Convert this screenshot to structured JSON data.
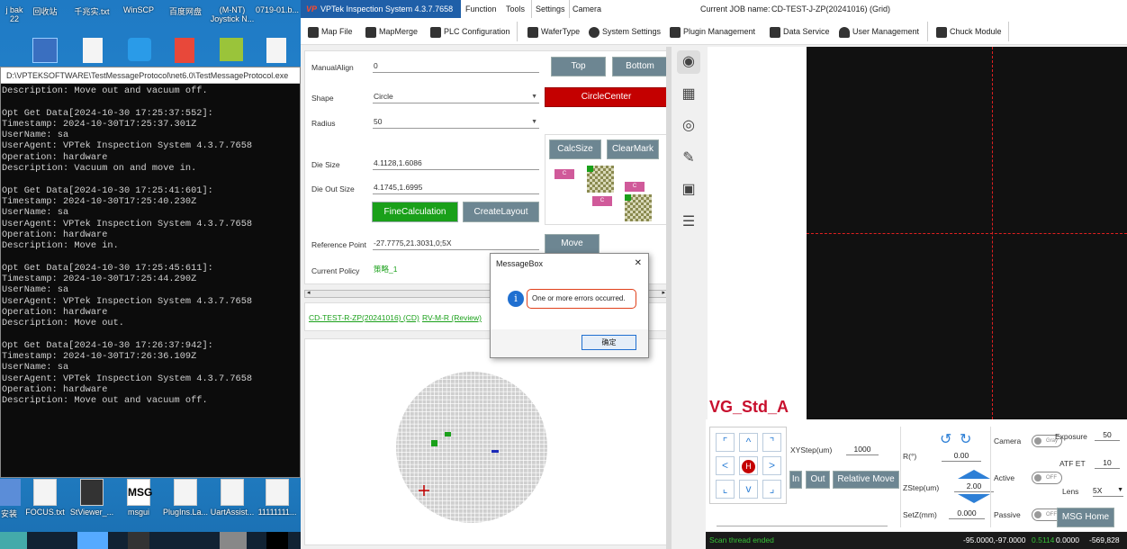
{
  "desktop": {
    "icons_top": [
      "j bak\n22",
      "回收站",
      "千兆实.txt",
      "WinSCP",
      "百度网盘",
      "(M-NT)\nJoystick N...",
      "0719-01.b..."
    ],
    "icons_bottom": [
      "安装",
      "FOCUS.txt",
      "StViewer_...",
      "msgui",
      "PlugIns.La...",
      "UartAssist...",
      "11111111..."
    ],
    "msg_icon_text": "MSG"
  },
  "console": {
    "title": "D:\\VPTEKSOFTWARE\\TestMessageProtocol\\net6.0\\TestMessageProtocol.exe",
    "lines": [
      "Description: Move out and vacuum off.",
      "",
      "Opt Get Data[2024-10-30 17:25:37:552]:",
      "Timestamp: 2024-10-30T17:25:37.301Z",
      "UserName: sa",
      "UserAgent: VPTek Inspection System 4.3.7.7658",
      "Operation: hardware",
      "Description: Vacuum on and move in.",
      "",
      "Opt Get Data[2024-10-30 17:25:41:601]:",
      "Timestamp: 2024-10-30T17:25:40.230Z",
      "UserName: sa",
      "UserAgent: VPTek Inspection System 4.3.7.7658",
      "Operation: hardware",
      "Description: Move in.",
      "",
      "Opt Get Data[2024-10-30 17:25:45:611]:",
      "Timestamp: 2024-10-30T17:25:44.290Z",
      "UserName: sa",
      "UserAgent: VPTek Inspection System 4.3.7.7658",
      "Operation: hardware",
      "Description: Move out.",
      "",
      "Opt Get Data[2024-10-30 17:26:37:942]:",
      "Timestamp: 2024-10-30T17:26:36.109Z",
      "UserName: sa",
      "UserAgent: VPTek Inspection System 4.3.7.7658",
      "Operation: hardware",
      "Description: Move out and vacuum off."
    ]
  },
  "app": {
    "logo_mark": "VP",
    "title": "VPTek Inspection System 4.3.7.7658",
    "menus": [
      "Function",
      "Tools",
      "Settings",
      "Camera"
    ],
    "current_job_label": "Current JOB name:",
    "current_job_value": "CD-TEST-J-ZP(20241016) (Grid)",
    "toolbar": [
      "Map File",
      "MapMerge",
      "PLC Configuration",
      "WaferType",
      "System Settings",
      "Plugin Management",
      "Data Service",
      "User Management",
      "Chuck Module"
    ]
  },
  "form": {
    "manual_align_label": "ManualAlign",
    "manual_align_value": "0",
    "top_btn": "Top",
    "bottom_btn": "Bottom",
    "shape_label": "Shape",
    "shape_value": "Circle",
    "circle_center_btn": "CircleCenter",
    "radius_label": "Radius",
    "radius_value": "50",
    "calc_size_btn": "CalcSize",
    "clear_mark_btn": "ClearMark",
    "die_size_label": "Die Size",
    "die_size_value": "4.1128,1.6086",
    "die_out_size_label": "Die Out Size",
    "die_out_size_value": "4.1745,1.6995",
    "fine_calc_btn": "FineCalculation",
    "create_layout_btn": "CreateLayout",
    "ref_point_label": "Reference Point",
    "ref_point_value": "-27.7775,21.3031,0;5X",
    "move_btn": "Move",
    "policy_label": "Current Policy",
    "policy_value": "策略_1",
    "diagram_labels": [
      "C",
      "C",
      "C"
    ]
  },
  "links": {
    "job": "CD-TEST-R-ZP(20241016) (CD)",
    "review": "RV-M-R (Review)"
  },
  "dialog": {
    "title": "MessageBox",
    "close": "✕",
    "info_icon": "i",
    "message": "One or more errors occurred.",
    "ok": "确定"
  },
  "camera": {
    "recipe_name": "VG_Std_A"
  },
  "control": {
    "dpad_up": "^",
    "dpad_left": "<",
    "dpad_right": ">",
    "dpad_down": "v",
    "dpad_home": "H",
    "xystep_label": "XYStep(um)",
    "xystep_value": "1000",
    "r_label": "R(°)",
    "r_value": "0.00",
    "zstep_label": "ZStep(um)",
    "zstep_value": "2.00",
    "setz_label": "SetZ(mm)",
    "setz_value": "0.000",
    "in_btn": "In",
    "out_btn": "Out",
    "relative_move_btn": "Relative Move",
    "camera_label": "Camera",
    "camera_toggle": "Gray",
    "active_label": "Active",
    "active_toggle": "OFF",
    "passive_label": "Passive",
    "passive_toggle": "OFF",
    "exposure_label": "Exposure",
    "exposure_value": "50",
    "atf_label": "ATF ET",
    "atf_value": "10",
    "lens_label": "Lens",
    "lens_value": "5X",
    "msg_home_btn": "MSG Home"
  },
  "status": {
    "left": "Scan thread ended",
    "coords_a": "-95.0000,-97.0000",
    "coords_b": "0.5114",
    "coords_c": "0.0000",
    "coords_d": "-569,828"
  },
  "colors": {
    "accent_blue": "#1f5fa8",
    "button_gray": "#6d8692",
    "green": "#1aa01a",
    "red": "#c40000",
    "recipe_red": "#c8102e",
    "status_green": "#36c236"
  }
}
